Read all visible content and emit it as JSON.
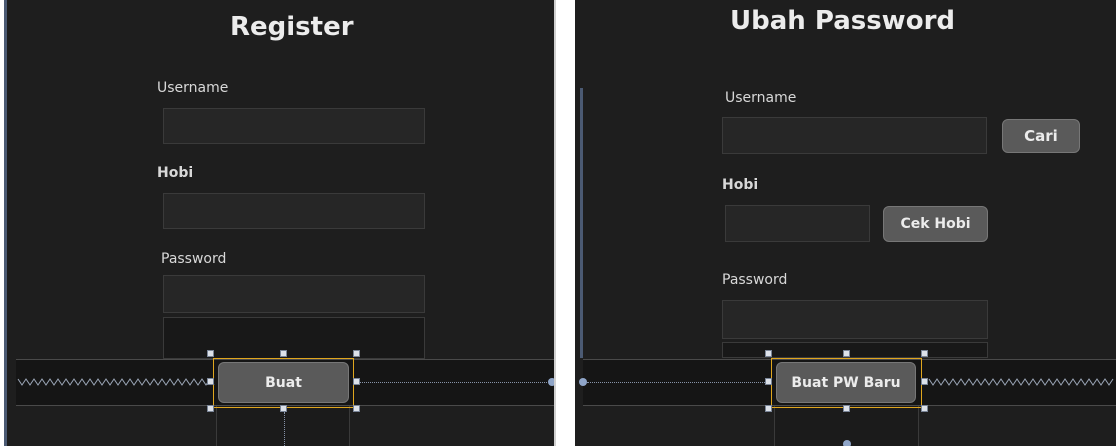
{
  "register_form": {
    "title": "Register",
    "username_label": "Username",
    "hobi_label": "Hobi",
    "password_label": "Password",
    "submit_label": "Buat"
  },
  "change_password_form": {
    "title": "Ubah Password",
    "username_label": "Username",
    "search_label": "Cari",
    "hobi_label": "Hobi",
    "check_hobi_label": "Cek Hobi",
    "password_label": "Password",
    "submit_label": "Buat PW Baru"
  },
  "colors": {
    "background": "#1e1e1e",
    "field": "#262626",
    "button": "#5a5a5a",
    "selection": "#e0a61e",
    "guide": "#8793a8"
  }
}
